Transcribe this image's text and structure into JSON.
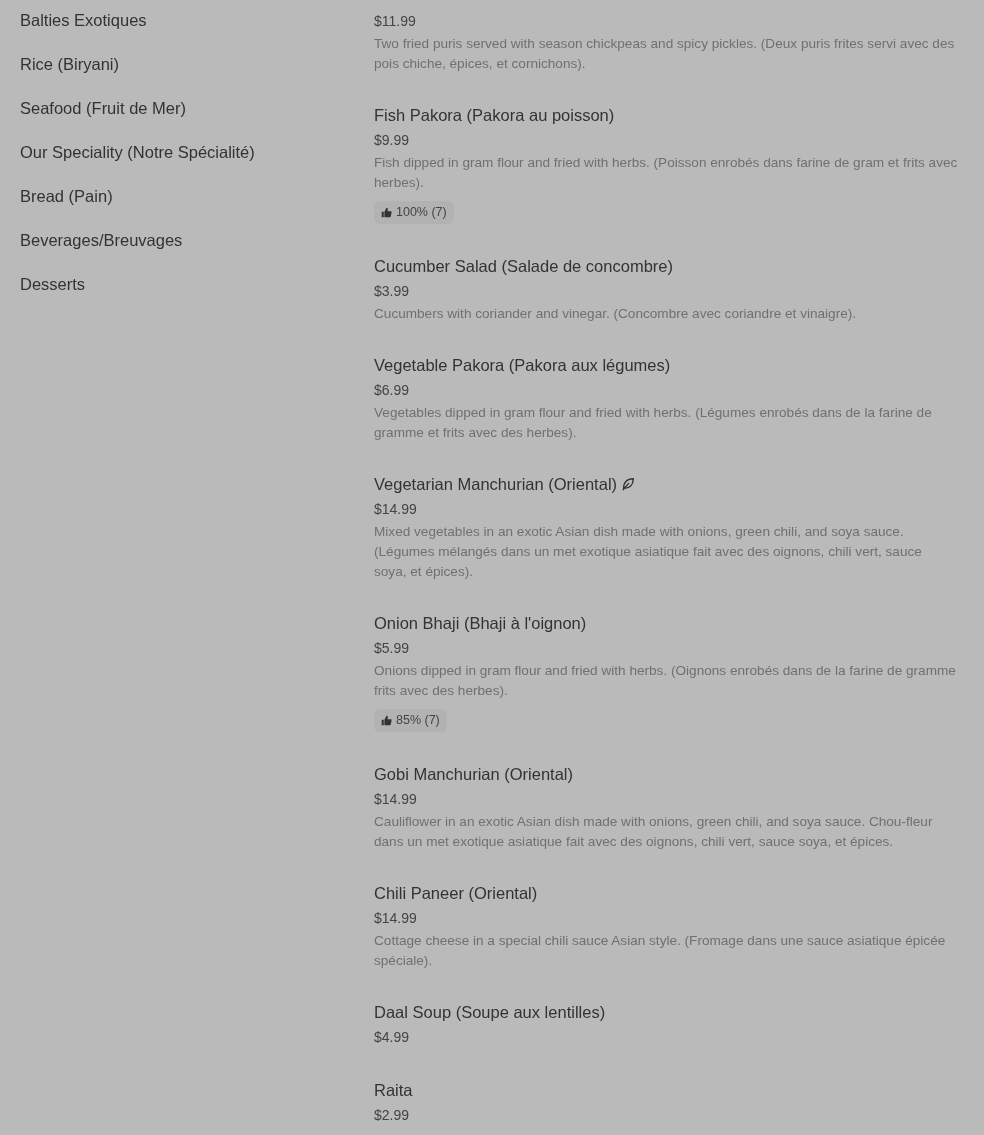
{
  "categories": [
    {
      "label": "Balties Exotiques"
    },
    {
      "label": "Rice (Biryani)"
    },
    {
      "label": "Seafood (Fruit de Mer)"
    },
    {
      "label": "Our Speciality (Notre Spécialité)"
    },
    {
      "label": "Bread (Pain)"
    },
    {
      "label": "Beverages/Breuvages"
    },
    {
      "label": "Desserts"
    }
  ],
  "items": [
    {
      "price": "$11.99",
      "description": "Two fried puris served with season chickpeas and spicy pickles. (Deux puris frites servi avec des pois chiche, épices, et cornichons).",
      "vegetarian": false
    },
    {
      "name": "Fish Pakora (Pakora au poisson)",
      "price": "$9.99",
      "description": "Fish dipped in gram flour and fried with herbs. (Poisson enrobés dans farine de gram et frits avec herbes).",
      "rating": "100% (7)",
      "vegetarian": false
    },
    {
      "name": "Cucumber Salad (Salade de concombre)",
      "price": "$3.99",
      "description": "Cucumbers with coriander and vinegar. (Concombre avec coriandre et vinaigre).",
      "vegetarian": false
    },
    {
      "name": "Vegetable Pakora (Pakora aux légumes)",
      "price": "$6.99",
      "description": "Vegetables dipped in gram flour and fried with herbs. (Légumes enrobés dans de la farine de gramme et frits avec des herbes).",
      "vegetarian": false
    },
    {
      "name": "Vegetarian Manchurian (Oriental)",
      "price": "$14.99",
      "description": "Mixed vegetables in an exotic Asian dish made with onions, green chili, and soya sauce. (Légumes mélangés dans un met exotique asiatique fait avec des oignons, chili vert, sauce soya, et épices).",
      "vegetarian": true
    },
    {
      "name": "Onion Bhaji (Bhaji à l'oignon)",
      "price": "$5.99",
      "description": "Onions dipped in gram flour and fried with herbs. (Oignons enrobés dans de la farine de gramme frits avec des herbes).",
      "rating": "85% (7)",
      "vegetarian": false
    },
    {
      "name": "Gobi Manchurian (Oriental)",
      "price": "$14.99",
      "description": "Cauliflower in an exotic Asian dish made with onions, green chili, and soya sauce. Chou-fleur dans un met exotique asiatique fait avec des oignons, chili vert, sauce soya, et épices.",
      "vegetarian": false
    },
    {
      "name": "Chili Paneer (Oriental)",
      "price": "$14.99",
      "description": "Cottage cheese in a special chili sauce Asian style. (Fromage dans une sauce asiatique épicée spéciale).",
      "vegetarian": false
    },
    {
      "name": "Daal Soup (Soupe aux lentilles)",
      "price": "$4.99",
      "vegetarian": false
    },
    {
      "name": "Raita",
      "price": "$2.99",
      "vegetarian": false
    }
  ]
}
